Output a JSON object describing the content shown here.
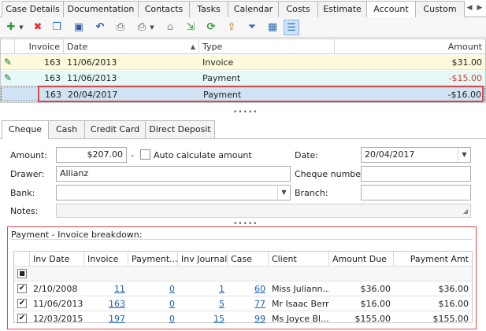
{
  "tabs": [
    {
      "label": "Case Details"
    },
    {
      "label": "Documentation"
    },
    {
      "label": "Contacts"
    },
    {
      "label": "Tasks"
    },
    {
      "label": "Calendar"
    },
    {
      "label": "Costs"
    },
    {
      "label": "Estimate"
    },
    {
      "label": "Account"
    },
    {
      "label": "Custom"
    }
  ],
  "active_tab": "Account",
  "toolbar": {
    "icons": [
      "add-icon",
      "delete-icon",
      "copy-icon",
      "save-icon",
      "undo-icon",
      "preview-icon",
      "print-icon",
      "home-icon",
      "export-icon",
      "refresh-icon",
      "upload-icon",
      "filter-icon",
      "grid-icon",
      "layout-icon"
    ]
  },
  "grid": {
    "columns": {
      "invoice": "Invoice",
      "date": "Date",
      "type": "Type",
      "amount": "Amount"
    },
    "rows": [
      {
        "invoice": "163",
        "date": "11/06/2013",
        "type": "Invoice",
        "amount": "$31.00",
        "bg": "#fdfbdc",
        "amount_color": "#222222"
      },
      {
        "invoice": "163",
        "date": "11/06/2013",
        "type": "Payment",
        "amount": "-$15.00",
        "bg": "#e6f9f8",
        "amount_color": "#d83a2e"
      },
      {
        "invoice": "163",
        "date": "20/04/2017",
        "type": "Payment",
        "amount": "-$16.00",
        "bg": "#cfe3f5",
        "amount_color": "#222222"
      }
    ]
  },
  "payment_tabs": [
    {
      "label": "Cheque"
    },
    {
      "label": "Cash"
    },
    {
      "label": "Credit Card"
    },
    {
      "label": "Direct Deposit"
    }
  ],
  "form": {
    "amount_label": "Amount:",
    "amount_value": "$207.00",
    "dash": "-",
    "auto_calc_label": "Auto calculate amount",
    "date_label": "Date:",
    "date_value": "20/04/2017",
    "drawer_label": "Drawer:",
    "drawer_value": "Allianz",
    "cheque_number_label": "Cheque number:",
    "cheque_number_value": "",
    "bank_label": "Bank:",
    "bank_value": "",
    "branch_label": "Branch:",
    "branch_value": "",
    "notes_label": "Notes:",
    "notes_value": ""
  },
  "breakdown": {
    "title": "Payment - Invoice breakdown:",
    "columns": {
      "inv_date": "Inv Date",
      "invoice": "Invoice",
      "payment": "Payment...",
      "inv_journal": "Inv Journal",
      "case": "Case",
      "client": "Client",
      "amount_due": "Amount Due",
      "payment_amt": "Payment Amt"
    },
    "rows": [
      {
        "checked": "✔",
        "inv_date": "2/10/2008",
        "invoice": "11",
        "payment": "0",
        "inv_journal": "1",
        "case": "60",
        "client": "Miss Juliann...",
        "amount_due": "$36.00",
        "payment_amt": "$36.00"
      },
      {
        "checked": "✔",
        "inv_date": "11/06/2013",
        "invoice": "163",
        "payment": "0",
        "inv_journal": "5",
        "case": "77",
        "client": "Mr Isaac Berry",
        "amount_due": "$16.00",
        "payment_amt": "$16.00"
      },
      {
        "checked": "✔",
        "inv_date": "12/03/2015",
        "invoice": "197",
        "payment": "0",
        "inv_journal": "15",
        "case": "99",
        "client": "Ms Joyce Bl...",
        "amount_due": "$155.00",
        "payment_amt": "$155.00"
      }
    ]
  },
  "colors": {
    "accent": "#d94b4b",
    "link": "#1a5fb4",
    "negative": "#d83a2e"
  }
}
